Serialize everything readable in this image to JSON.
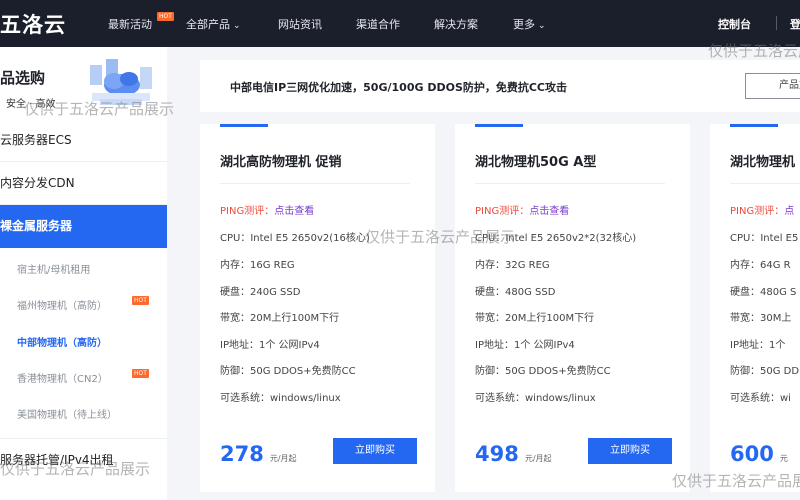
{
  "nav": {
    "logo": "五洛云",
    "items": [
      {
        "label": "最新活动",
        "badge": "HOT"
      },
      {
        "label": "全部产品",
        "chevron": true
      },
      {
        "label": "网站资讯"
      },
      {
        "label": "渠道合作"
      },
      {
        "label": "解决方案"
      },
      {
        "label": "更多",
        "chevron": true
      }
    ],
    "console": "控制台",
    "login": "登"
  },
  "sidebar": {
    "title": "品选购",
    "subtitle": "安全 · 高效",
    "categories": [
      {
        "label": "云服务器ECS"
      },
      {
        "label": "内容分发CDN"
      },
      {
        "label": "裸金属服务器"
      }
    ],
    "sub_items": [
      {
        "label": "宿主机/母机租用"
      },
      {
        "label": "福州物理机（高防）",
        "badge": "HOT"
      },
      {
        "label": "中部物理机（高防）"
      },
      {
        "label": "香港物理机（CN2）",
        "badge": "HOT"
      },
      {
        "label": "美国物理机（待上线）"
      }
    ],
    "bottom_category": "服务器托管/IPv4出租"
  },
  "banner": {
    "text": "中部电信IP三网优化加速，50G/100G DDOS防护，免费抗CC攻击",
    "button": "产品文"
  },
  "cards": [
    {
      "title": "湖北高防物理机 促销",
      "ping_label": "PING测评：",
      "ping_link": "点击查看",
      "cpu": "CPU：Intel E5 2650v2(16核心)",
      "mem": "内存：16G REG",
      "disk": "硬盘：240G SSD",
      "bw": "带宽：20M上行100M下行",
      "ip": "IP地址：1个 公网IPv4",
      "ddos": "防御：50G DDOS+免费防CC",
      "os": "可选系统：windows/linux",
      "price": "278",
      "unit": "元/月起",
      "buy": "立即购买"
    },
    {
      "title": "湖北物理机50G A型",
      "ping_label": "PING测评：",
      "ping_link": "点击查看",
      "cpu": "CPU：Intel E5 2650v2*2(32核心)",
      "mem": "内存：32G REG",
      "disk": "硬盘：480G SSD",
      "bw": "带宽：20M上行100M下行",
      "ip": "IP地址：1个 公网IPv4",
      "ddos": "防御：50G DDOS+免费防CC",
      "os": "可选系统：windows/linux",
      "price": "498",
      "unit": "元/月起",
      "buy": "立即购买"
    },
    {
      "title": "湖北物理机",
      "ping_label": "PING测评：",
      "ping_link": "点",
      "cpu": "CPU：Intel E5",
      "mem": "内存：64G R",
      "disk": "硬盘：480G S",
      "bw": "带宽：30M上",
      "ip": "IP地址：1个",
      "ddos": "防御：50G DD",
      "os": "可选系统：wi",
      "price": "600",
      "unit": "元",
      "buy": ""
    }
  ],
  "watermark": "仅供于五洛云产品展示"
}
